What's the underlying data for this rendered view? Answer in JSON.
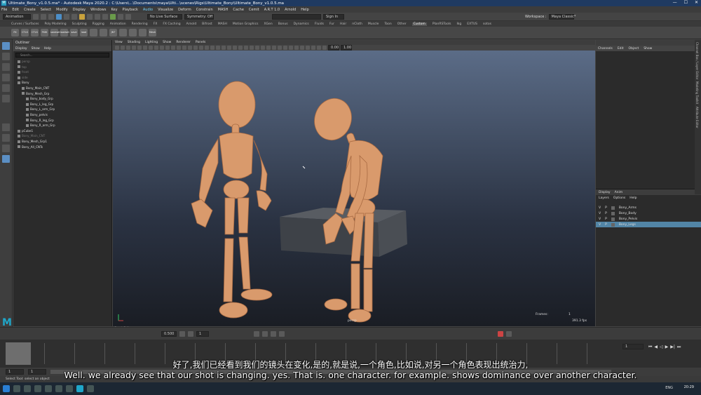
{
  "window": {
    "title": "Ultimate_Bony_v1.0.5.ma* - Autodesk Maya 2020.2 : C:\\Users\\...\\Documents\\maya\\Ulti...\\scenes\\Rigs\\Ultimate_Bony\\Ultimate_Bony_v1.0.5.ma",
    "min": "—",
    "max": "☐",
    "close": "✕"
  },
  "menus": [
    "File",
    "Edit",
    "Create",
    "Select",
    "Modify",
    "Display",
    "Windows",
    "Key",
    "Playback",
    "Audio",
    "Visualize",
    "Deform",
    "Constrain",
    "MASH",
    "Cache",
    "Cemit",
    "A.R.T 1.0",
    "Arnold",
    "Help"
  ],
  "statusline": {
    "workspace_mode": "Animation",
    "no_live_surface": "No Live Surface",
    "symmetry": "Symmetry: Off",
    "sign_in": "Sign In",
    "workspace_label": "Workspace :",
    "workspace_value": "Maya Classic*"
  },
  "shelf_tabs": [
    "Curves / Surfaces",
    "Poly Modeling",
    "Sculpting",
    "Rigging",
    "Animation",
    "Rendering",
    "FX",
    "FX Caching",
    "Arnold",
    "Bifrost",
    "MASH",
    "Motion Graphics",
    "XGen",
    "Bonus",
    "Dynamics",
    "Fluids",
    "Fur",
    "Hair",
    "nCloth",
    "Muscle",
    "Toon",
    "Other",
    "Custom",
    "PlanRSTools",
    "Ikg",
    "EXTUS",
    "sotos"
  ],
  "shelf_active": "Custom",
  "shelf_icons": [
    "FK",
    "CTLS",
    "CTLS",
    "FKIK",
    "saveset",
    "loadset",
    "save",
    "load",
    "",
    "",
    "JNT",
    "",
    "",
    "",
    "Mesh"
  ],
  "outliner": {
    "title": "Outliner",
    "menu": [
      "Display",
      "Show",
      "Help"
    ],
    "search_placeholder": "Search...",
    "items": [
      {
        "label": "persp",
        "indent": 0,
        "dim": true
      },
      {
        "label": "top",
        "indent": 0,
        "dim": true
      },
      {
        "label": "front",
        "indent": 0,
        "dim": true
      },
      {
        "label": "side",
        "indent": 0,
        "dim": true
      },
      {
        "label": "Bony",
        "indent": 0,
        "dim": false
      },
      {
        "label": "Bony_Main_CNT",
        "indent": 1,
        "dim": false
      },
      {
        "label": "Bony_Mesh_Grp",
        "indent": 1,
        "dim": false
      },
      {
        "label": "Bony_body_Grp",
        "indent": 2,
        "dim": false
      },
      {
        "label": "Bony_L_leg_Grp",
        "indent": 2,
        "dim": false
      },
      {
        "label": "Bony_L_arm_Grp",
        "indent": 2,
        "dim": false
      },
      {
        "label": "Bony_pelvis",
        "indent": 2,
        "dim": false
      },
      {
        "label": "Bony_R_leg_Grp",
        "indent": 2,
        "dim": false
      },
      {
        "label": "Bony_R_arm_Grp",
        "indent": 2,
        "dim": false
      },
      {
        "label": "pCube1",
        "indent": 0,
        "dim": false
      },
      {
        "label": "Bony_Main_CNT",
        "indent": 0,
        "dim": true
      },
      {
        "label": "Bony_Mesh_Grp1",
        "indent": 0,
        "dim": false
      },
      {
        "label": "Bony_All_CNTs",
        "indent": 0,
        "dim": false
      }
    ]
  },
  "viewport": {
    "menu": [
      "View",
      "Shading",
      "Lighting",
      "Show",
      "Renderer",
      "Panels"
    ],
    "camera": "persp",
    "frames_label": "Frames:",
    "frames_value": "1",
    "fps": "391.3 fps",
    "field1": "0.00",
    "field2": "1.00"
  },
  "channel_box": {
    "menu": [
      "Channels",
      "Edit",
      "Object",
      "Show"
    ]
  },
  "layers": {
    "tabs": [
      "Display",
      "Anim"
    ],
    "menu": [
      "Layers",
      "Options",
      "Help"
    ],
    "rows": [
      {
        "v": "V",
        "p": "P",
        "name": "Bony_Arms",
        "selected": false
      },
      {
        "v": "V",
        "p": "P",
        "name": "Bony_Body",
        "selected": false
      },
      {
        "v": "V",
        "p": "P",
        "name": "Bony_Pelvis",
        "selected": false
      },
      {
        "v": "V",
        "p": "P",
        "name": "Bony_Legs",
        "selected": true
      }
    ]
  },
  "side_tabs": [
    "Channel Box / Layer Editor",
    "Modeling Toolkit",
    "Attribute Editor"
  ],
  "graph_label": "Graph Editor",
  "timebar": {
    "field": "0.500",
    "current_frame": "1"
  },
  "timeline": {
    "ticks": [
      "1",
      "",
      "",
      "",
      "",
      "",
      "",
      "",
      "",
      "",
      "",
      "",
      "",
      "",
      "",
      "",
      "",
      "",
      "",
      "",
      "120"
    ]
  },
  "range": {
    "start": "1",
    "end": "1",
    "anim_start": "1",
    "anim_end": "200",
    "current": "1"
  },
  "help_line": "Select Tool: select an object",
  "taskbar": {
    "lang": "ENG",
    "time": "20:29"
  },
  "subtitles": {
    "cn": "好了,我们已经看到我们的镜头在变化,是的,就是说,一个角色,比如说,对另一个角色表现出统治力,",
    "en": "Well. we already see that our shot is changing. yes. That is. one character. for example. shows dominance over another character."
  },
  "colors": {
    "title_bar": "#1f3a61",
    "skin": "#d99a6c",
    "accent": "#5285a6",
    "maya_blue": "#1fa6c9"
  }
}
